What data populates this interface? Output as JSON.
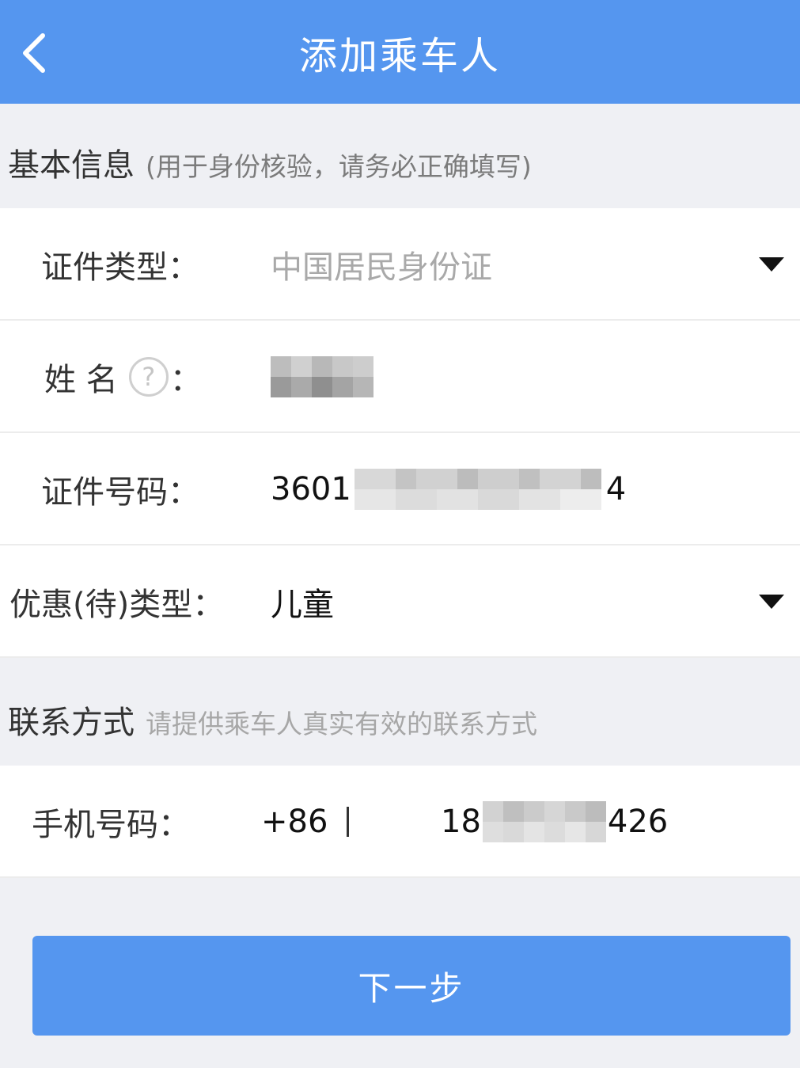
{
  "header": {
    "title": "添加乘车人",
    "back_icon": "chevron-left-icon"
  },
  "basic_section": {
    "title": "基本信息",
    "hint": "(用于身份核验，请务必正确填写)"
  },
  "form": {
    "id_type": {
      "label": "证件类型：",
      "value": "中国居民身份证"
    },
    "name": {
      "label": "姓 名",
      "label_suffix": "：",
      "help_icon": "question-circle-icon",
      "help_glyph": "?",
      "value": ""
    },
    "id_number": {
      "label": "证件号码：",
      "value_start": "3601",
      "value_end": "4"
    },
    "discount_type": {
      "label": "优惠(待)类型：",
      "value": "儿童"
    }
  },
  "contact_section": {
    "title": "联系方式",
    "hint": "请提供乘车人真实有效的联系方式"
  },
  "phone": {
    "label": "手机号码：",
    "country_code": "+86",
    "value_start": "18",
    "value_end": "426"
  },
  "actions": {
    "next_label": "下一步"
  },
  "colors": {
    "brand": "#5596ef",
    "background": "#eff0f4",
    "placeholder": "#a9a9a9"
  }
}
